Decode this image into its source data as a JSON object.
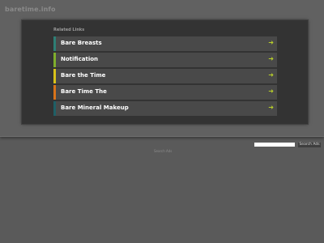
{
  "site": {
    "title": "baretime.info"
  },
  "related": {
    "heading": "Related Links",
    "items": [
      {
        "label": "Bare Breasts",
        "accent": "#2e7f75"
      },
      {
        "label": "Notification",
        "accent": "#7fae2c"
      },
      {
        "label": "Bare the Time",
        "accent": "#d8c21a"
      },
      {
        "label": "Bare Time The",
        "accent": "#d8731a"
      },
      {
        "label": "Bare Mineral Makeup",
        "accent": "#1f5f66"
      }
    ],
    "arrow_color": "#b8cf2a"
  },
  "search": {
    "button_label": "Search Ads",
    "value": ""
  },
  "footer": {
    "link_label": "Search Ads"
  }
}
